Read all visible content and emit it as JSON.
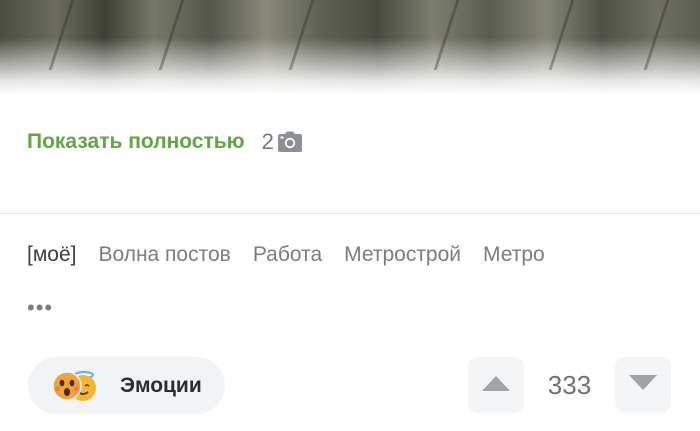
{
  "post": {
    "show_more_label": "Показать полностью",
    "photo_count": "2",
    "photo_icon": "camera-icon"
  },
  "tags": [
    {
      "label": "[моё]"
    },
    {
      "label": "Волна постов"
    },
    {
      "label": "Работа"
    },
    {
      "label": "Метрострой"
    },
    {
      "label": "Метро"
    }
  ],
  "tags_more_label": "•••",
  "emotions": {
    "label": "Эмоции",
    "icons": [
      "shocked-face-icon",
      "angel-face-icon"
    ]
  },
  "rating": {
    "value": "333",
    "upvote_icon": "triangle-up-icon",
    "downvote_icon": "triangle-down-icon"
  },
  "colors": {
    "link": "#61a645",
    "muted_text": "#7a7d82",
    "button_bg": "#f2f3f5",
    "vote_arrow": "#a0a3a8"
  }
}
